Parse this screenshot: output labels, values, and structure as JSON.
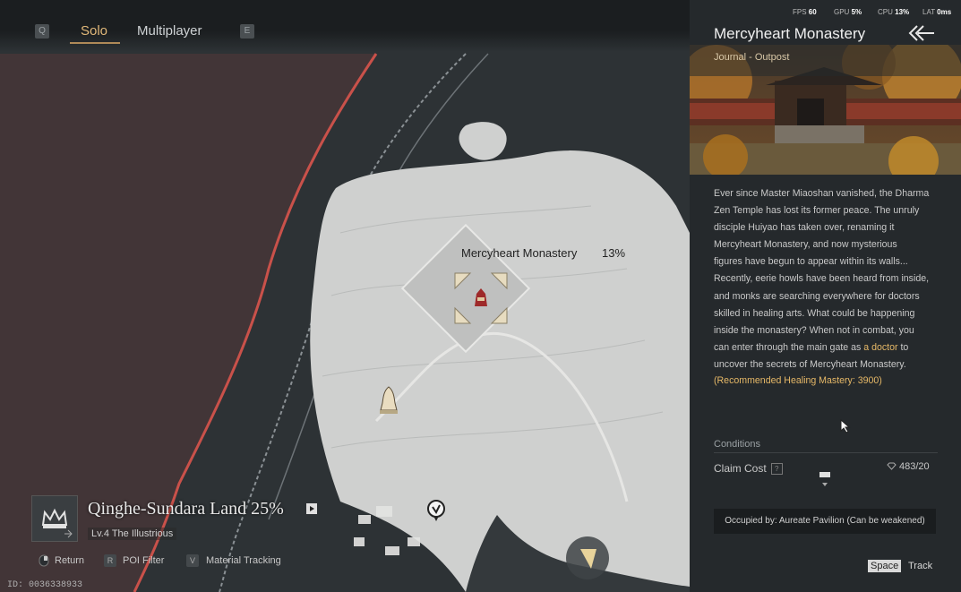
{
  "perf": {
    "fps_label": "FPS",
    "fps": "60",
    "gpu_label": "GPU",
    "gpu": "5%",
    "cpu_label": "CPU",
    "cpu": "13%",
    "lat_label": "LAT",
    "lat": "0ms"
  },
  "tabs": {
    "prev_key": "Q",
    "solo": "Solo",
    "multiplayer": "Multiplayer",
    "next_key": "E"
  },
  "map": {
    "poi_name": "Mercyheart Monastery",
    "poi_progress": "13%",
    "region_name": "Qinghe-Sundara Land 25%",
    "region_sub": "Lv.4 The Illustrious",
    "id": "ID: 0036338933"
  },
  "hints": [
    {
      "key": "",
      "label": "Return"
    },
    {
      "key": "R",
      "label": "POI Filter"
    },
    {
      "key": "V",
      "label": "Material Tracking"
    }
  ],
  "panel": {
    "title": "Mercyheart Monastery",
    "subtitle": "Journal - Outpost",
    "description_lines": [
      "Ever since Master Miaoshan vanished, the Dharma",
      "Zen Temple has lost its former peace. The unruly",
      "disciple Huiyao has taken over, renaming it",
      "Mercyheart Monastery, and now mysterious",
      "figures have begun to appear within its walls...",
      "Recently, eerie howls have been heard from inside,",
      "and monks are searching everywhere for doctors",
      "skilled in healing arts. What could be happening",
      "inside the monastery? When not in combat, you"
    ],
    "desc_pre": "can enter through the main gate as ",
    "desc_link": "a doctor",
    "desc_post": " to",
    "desc_last": "uncover the secrets of Mercyheart Monastery.",
    "recommended": "(Recommended Healing Mastery: 3900)",
    "conditions_label": "Conditions",
    "claim_label": "Claim Cost",
    "claim_help": "?",
    "claim_value": "483/20",
    "occupied": "Occupied by: Aureate Pavilion (Can be weakened)",
    "space_key": "Space",
    "track_label": "Track"
  },
  "colors": {
    "accent": "#e2b97a",
    "highlight": "#e6b867",
    "border_red": "#c9514a"
  }
}
